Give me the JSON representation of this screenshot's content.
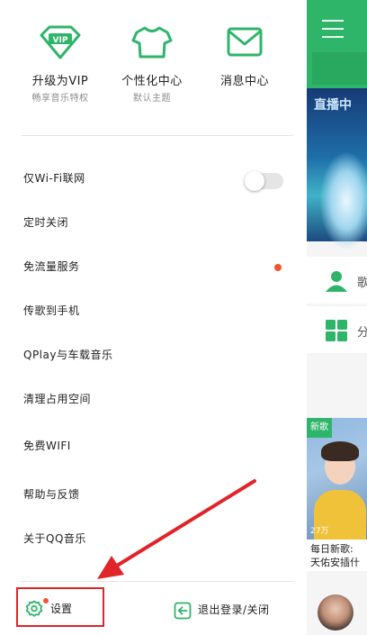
{
  "colors": {
    "brand_green": "#2eb56a",
    "highlight_red": "#e0242a",
    "dot_red": "#f2542d",
    "divider": "#e4e4e4"
  },
  "drawer": {
    "top_items": [
      {
        "icon": "vip-diamond-icon",
        "label": "升级为VIP",
        "sublabel": "畅享音乐特权"
      },
      {
        "icon": "tshirt-icon",
        "label": "个性化中心",
        "sublabel": "默认主题"
      },
      {
        "icon": "envelope-icon",
        "label": "消息中心",
        "sublabel": ""
      }
    ],
    "menu_items": [
      {
        "label": "仅Wi-Fi联网",
        "control": "toggle",
        "toggle_on": false
      },
      {
        "label": "定时关闭"
      },
      {
        "label": "免流量服务",
        "control": "red-dot"
      },
      {
        "label": "传歌到手机"
      },
      {
        "label": "QPlay与车载音乐"
      },
      {
        "label": "清理占用空间"
      },
      {
        "label": "免费WIFI"
      },
      {
        "label": "帮助与反馈"
      },
      {
        "label": "关于QQ音乐"
      }
    ],
    "bottom": {
      "settings_label": "设置",
      "settings_icon": "gear-icon",
      "logout_label": "退出登录/关闭",
      "logout_icon": "exit-arrow-icon"
    }
  },
  "background_app": {
    "banner_text": "直播中",
    "row1_text": "歌",
    "row2_text": "分",
    "card_badge": "新歌",
    "card_plays": "27万",
    "card_title_line1": "每日新歌:",
    "card_title_line2": "天佑安插什"
  }
}
